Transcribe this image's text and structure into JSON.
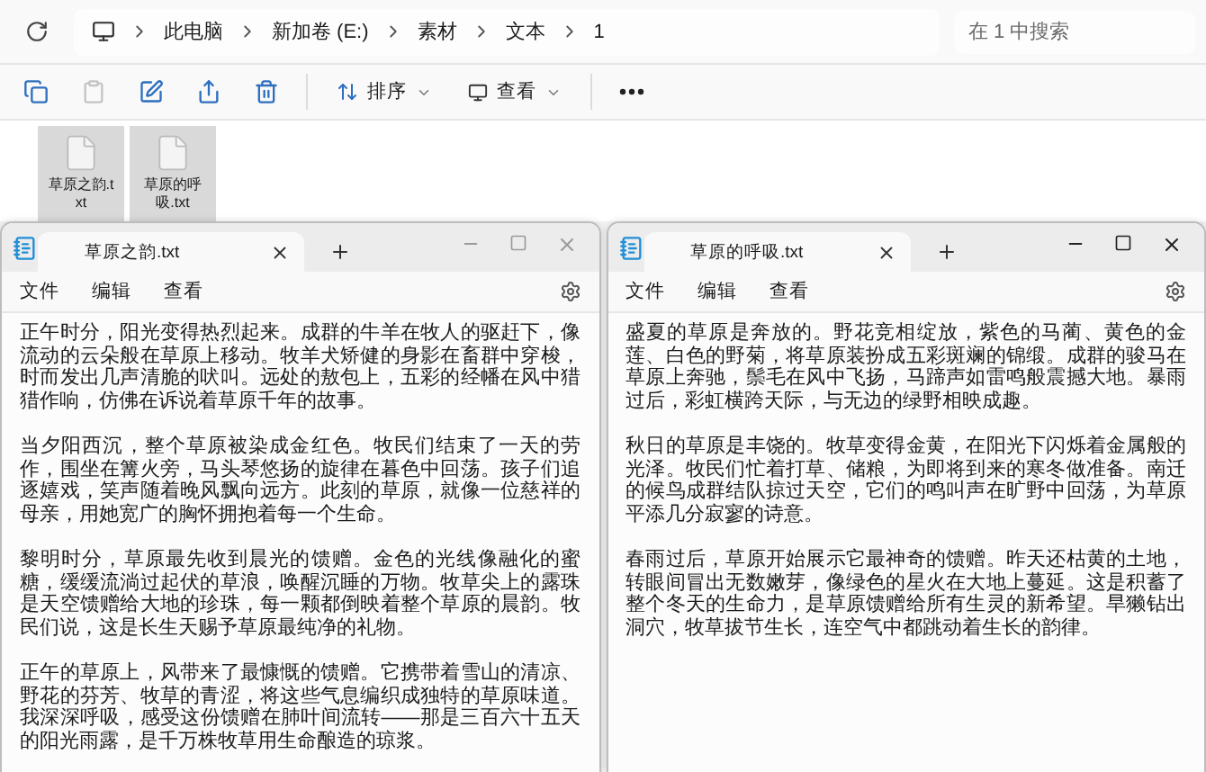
{
  "explorer": {
    "breadcrumbs": [
      "此电脑",
      "新加卷 (E:)",
      "素材",
      "文本",
      "1"
    ],
    "search": {
      "placeholder": "在 1 中搜索"
    },
    "actions": [
      {
        "disabled": false
      },
      {
        "disabled": true
      },
      {
        "disabled": false
      },
      {
        "disabled": false
      },
      {
        "disabled": false
      }
    ],
    "menus": [
      {
        "label": "排序"
      },
      {
        "label": "查看"
      }
    ],
    "files": [
      {
        "name": "草原之韵.txt",
        "selected": true
      },
      {
        "name": "草原的呼吸.txt",
        "selected": true
      }
    ]
  },
  "windows": [
    {
      "tab_title": "草原之韵.txt",
      "active": false,
      "menu": [
        "文件",
        "编辑",
        "查看"
      ],
      "paragraphs": [
        "正午时分，阳光变得热烈起来。成群的牛羊在牧人的驱赶下，像流动的云朵般在草原上移动。牧羊犬矫健的身影在畜群中穿梭，时而发出几声清脆的吠叫。远处的敖包上，五彩的经幡在风中猎猎作响，仿佛在诉说着草原千年的故事。",
        "当夕阳西沉，整个草原被染成金红色。牧民们结束了一天的劳作，围坐在篝火旁，马头琴悠扬的旋律在暮色中回荡。孩子们追逐嬉戏，笑声随着晚风飘向远方。此刻的草原，就像一位慈祥的母亲，用她宽广的胸怀拥抱着每一个生命。",
        "黎明时分，草原最先收到晨光的馈赠。金色的光线像融化的蜜糖，缓缓流淌过起伏的草浪，唤醒沉睡的万物。牧草尖上的露珠是天空馈赠给大地的珍珠，每一颗都倒映着整个草原的晨韵。牧民们说，这是长生天赐予草原最纯净的礼物。",
        "正午的草原上，风带来了最慷慨的馈赠。它携带着雪山的清凉、野花的芬芳、牧草的青涩，将这些气息编织成独特的草原味道。我深深呼吸，感受这份馈赠在肺叶间流转——那是三百六十五天的阳光雨露，是千万株牧草用生命酿造的琼浆。"
      ]
    },
    {
      "tab_title": "草原的呼吸.txt",
      "active": true,
      "menu": [
        "文件",
        "编辑",
        "查看"
      ],
      "paragraphs": [
        "盛夏的草原是奔放的。野花竞相绽放，紫色的马蔺、黄色的金莲、白色的野菊，将草原装扮成五彩斑斓的锦缎。成群的骏马在草原上奔驰，鬃毛在风中飞扬，马蹄声如雷鸣般震撼大地。暴雨过后，彩虹横跨天际，与无边的绿野相映成趣。",
        "秋日的草原是丰饶的。牧草变得金黄，在阳光下闪烁着金属般的光泽。牧民们忙着打草、储粮，为即将到来的寒冬做准备。南迁的候鸟成群结队掠过天空，它们的鸣叫声在旷野中回荡，为草原平添几分寂寥的诗意。",
        "春雨过后，草原开始展示它最神奇的馈赠。昨天还枯黄的土地，转眼间冒出无数嫩芽，像绿色的星火在大地上蔓延。这是积蓄了整个冬天的生命力，是草原馈赠给所有生灵的新希望。旱獭钻出洞穴，牧草拔节生长，连空气中都跳动着生长的韵律。"
      ]
    }
  ]
}
